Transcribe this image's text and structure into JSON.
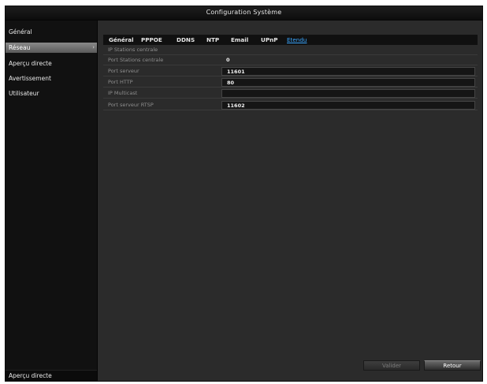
{
  "window": {
    "title": "Configuration Système"
  },
  "sidebar": {
    "items": [
      {
        "label": "Général"
      },
      {
        "label": "Réseau",
        "arrow": "›"
      },
      {
        "label": "Aperçu directe"
      },
      {
        "label": "Avertissement"
      },
      {
        "label": "Utilisateur"
      }
    ],
    "bottom_label": "Aperçu directe"
  },
  "tabs": [
    {
      "label": "Général"
    },
    {
      "label": "PPPOE"
    },
    {
      "label": "DDNS"
    },
    {
      "label": "NTP"
    },
    {
      "label": "Email"
    },
    {
      "label": "UPnP"
    },
    {
      "label": "Etendu"
    }
  ],
  "fields": [
    {
      "label": "IP Stations centrale",
      "value": ""
    },
    {
      "label": "Port Stations centrale",
      "value": "0"
    },
    {
      "label": "Port serveur",
      "value": "11601"
    },
    {
      "label": "Port HTTP",
      "value": "80"
    },
    {
      "label": "IP Multicast",
      "value": ""
    },
    {
      "label": "Port serveur RTSP",
      "value": "11602"
    }
  ],
  "buttons": {
    "apply": "Valider",
    "back": "Retour"
  },
  "colors": {
    "active_tab": "#3aa6ff",
    "background": "#2b2b2b",
    "sidebar": "#111111"
  }
}
